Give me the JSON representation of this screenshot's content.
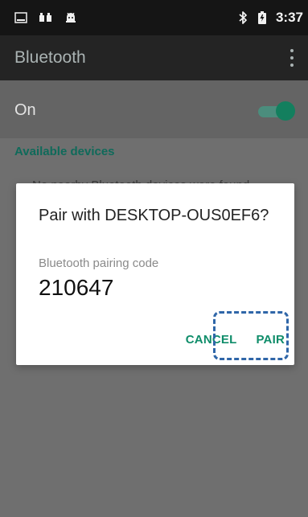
{
  "status_bar": {
    "time": "3:37",
    "left_icons": [
      "gallery-icon",
      "video-icon",
      "android-icon"
    ],
    "right_icons": [
      "bluetooth-icon",
      "battery-charging-icon"
    ]
  },
  "action_bar": {
    "title": "Bluetooth",
    "menu_icon": "overflow-menu-icon"
  },
  "settings": {
    "on_label": "On",
    "toggle_state": "on"
  },
  "available_devices": {
    "header": "Available devices",
    "partial_text": "No nearby Bluetooth devices were found"
  },
  "dialog": {
    "title": "Pair with DESKTOP-OUS0EF6?",
    "subtitle": "Bluetooth pairing code",
    "code": "210647",
    "cancel_label": "CANCEL",
    "pair_label": "PAIR"
  },
  "colors": {
    "accent": "#0f8d6a",
    "highlight": "#2f66a8"
  }
}
